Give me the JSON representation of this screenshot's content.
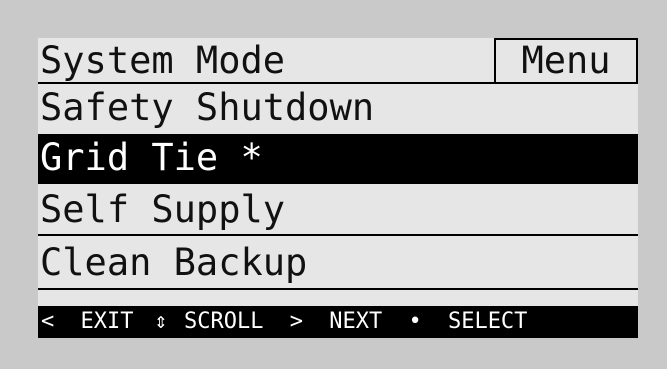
{
  "header": {
    "title": "System Mode",
    "menu_label": "Menu"
  },
  "menu_items": [
    {
      "label": "Safety Shutdown"
    },
    {
      "label": "Grid Tie *",
      "selected": true
    },
    {
      "label": "Self Supply"
    },
    {
      "label": "Clean Backup"
    }
  ],
  "footer": {
    "exit_arrow": "<",
    "exit_label": "EXIT",
    "scroll_icon": "⇕",
    "scroll_label": "SCROLL",
    "next_arrow": ">",
    "next_label": "NEXT",
    "select_dot": "•",
    "select_label": "SELECT"
  },
  "colors": {
    "background": "#c9c9c9",
    "screen": "#e6e6e6",
    "highlight": "#000000",
    "highlight_text": "#ffffff"
  }
}
